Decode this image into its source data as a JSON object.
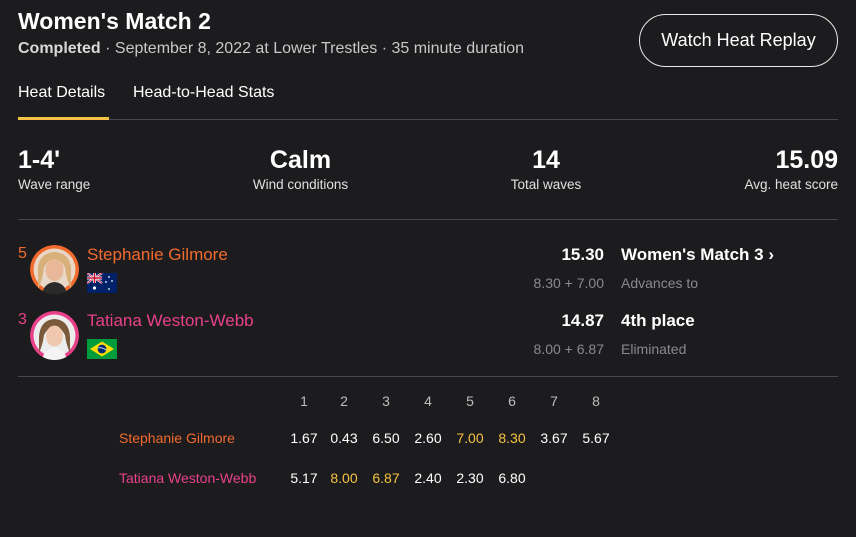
{
  "header": {
    "title": "Women's Match 2",
    "status": "Completed",
    "details": " · September 8, 2022 at Lower Trestles · 35 minute duration",
    "replay_button": "Watch Heat Replay"
  },
  "tabs": [
    {
      "label": "Heat Details",
      "active": true
    },
    {
      "label": "Head-to-Head Stats",
      "active": false
    }
  ],
  "stats": [
    {
      "value": "1-4'",
      "label": "Wave range"
    },
    {
      "value": "Calm",
      "label": "Wind conditions"
    },
    {
      "value": "14",
      "label": "Total waves"
    },
    {
      "value": "15.09",
      "label": "Avg. heat score"
    }
  ],
  "athletes": [
    {
      "seed": "5",
      "name": "Stephanie Gilmore",
      "flag_icon": "australia-flag-icon",
      "score": "15.30",
      "best_waves": "8.30 + 7.00",
      "result": "Women's Match 3",
      "result_arrow": "›",
      "result_sub": "Advances to",
      "color": "#f26a2e"
    },
    {
      "seed": "3",
      "name": "Tatiana Weston-Webb",
      "flag_icon": "brazil-flag-icon",
      "score": "14.87",
      "best_waves": "8.00 + 6.87",
      "result": "4th place",
      "result_sub": "Eliminated",
      "color": "#e8418a"
    }
  ],
  "wave_table": {
    "columns": [
      "1",
      "2",
      "3",
      "4",
      "5",
      "6",
      "7",
      "8"
    ],
    "rows": [
      {
        "name": "Stephanie Gilmore",
        "scores": [
          "1.67",
          "0.43",
          "6.50",
          "2.60",
          "7.00",
          "8.30",
          "3.67",
          "5.67"
        ],
        "highlight": [
          4,
          5
        ]
      },
      {
        "name": "Tatiana Weston-Webb",
        "scores": [
          "5.17",
          "8.00",
          "6.87",
          "2.40",
          "2.30",
          "6.80"
        ],
        "highlight": [
          1,
          2
        ]
      }
    ]
  },
  "colors": {
    "background": "#1c1c1e",
    "accent": "#f6c244",
    "athlete_1": "#f26a2e",
    "athlete_2": "#e8418a"
  }
}
